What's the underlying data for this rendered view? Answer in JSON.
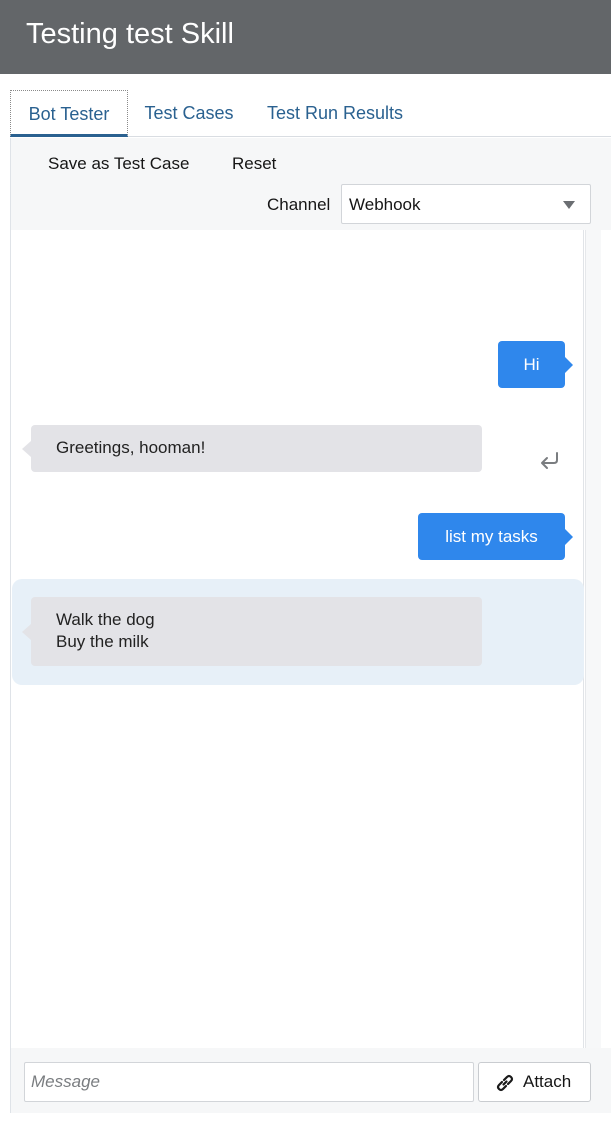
{
  "header": {
    "title": "Testing test Skill"
  },
  "tabs": [
    {
      "label": "Bot Tester",
      "active": true
    },
    {
      "label": "Test Cases",
      "active": false
    },
    {
      "label": "Test Run Results",
      "active": false
    }
  ],
  "toolbar": {
    "save_label": "Save as Test Case",
    "reset_label": "Reset",
    "channel_label": "Channel",
    "channel_value": "Webhook"
  },
  "conversation": {
    "messages": [
      {
        "from": "user",
        "text": "Hi"
      },
      {
        "from": "bot",
        "lines": [
          "Greetings, hooman!"
        ]
      },
      {
        "from": "user",
        "text": "list my tasks"
      },
      {
        "from": "bot",
        "lines": [
          "Walk the dog",
          "Buy the milk"
        ]
      }
    ]
  },
  "composer": {
    "placeholder": "Message",
    "attach_label": "Attach"
  },
  "icons": {
    "return": "return-arrow-icon",
    "attach": "link-icon",
    "dropdown": "chevron-down-icon"
  },
  "colors": {
    "header_bg": "#636669",
    "user_bubble": "#2f87ec",
    "bot_bubble": "#e3e3e7",
    "tab_text": "#2a6190",
    "highlight_bg": "#e7f0f8"
  }
}
